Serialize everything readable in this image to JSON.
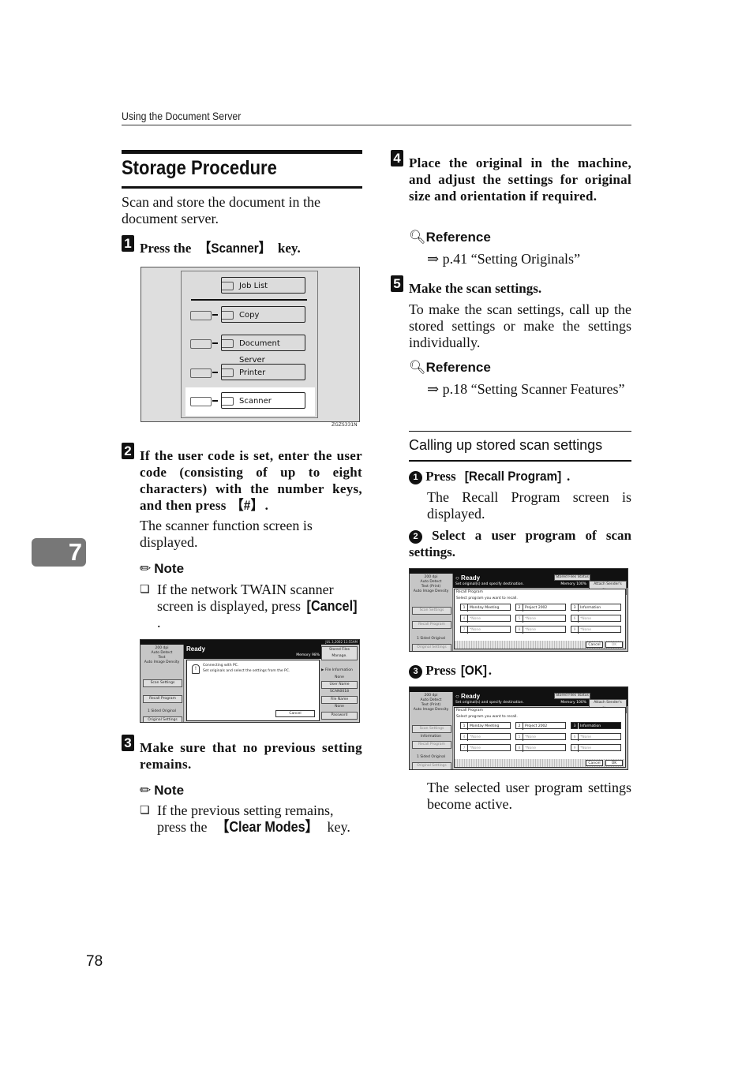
{
  "running_header": "Using the Document Server",
  "title": "Storage Procedure",
  "intro": "Scan and store the document in the document server.",
  "chapter_tab": "7",
  "page_number": "78",
  "steps": {
    "s1": {
      "num": "1",
      "pre": "Press the ",
      "key": "【Scanner】",
      "post": " key.",
      "figure": {
        "keys": [
          "Job List",
          "Copy",
          "Document Server",
          "Printer",
          "Scanner"
        ],
        "highlighted": "Scanner",
        "code": "ZGZS331N"
      }
    },
    "s2": {
      "num": "2",
      "text": "If the user code is set, enter the user code (consisting of up to eight characters) with the number keys, and then press ",
      "key": "【#】",
      "end": ".",
      "body": "The scanner function screen is displayed.",
      "note_title": "Note",
      "note_pre": "If the network TWAIN scanner screen is displayed, press ",
      "note_key": "[Cancel]",
      "note_post": ".",
      "screen": {
        "datetime": "JUL   3,2002 11:55AM",
        "status": "Ready",
        "memory": "Memory 98%",
        "left_info": [
          "200 dpi",
          "Auto Detect",
          "Text",
          "Auto Image Density"
        ],
        "left_buttons": [
          "Scan Settings",
          "Recall Program"
        ],
        "left_bottom_label": "1 Sided Original",
        "left_bottom_button": "Original Settings",
        "dialog_line1": "Connecting with PC.",
        "dialog_line2": "Set originals and select the settings from the PC.",
        "dialog_cancel": "Cancel",
        "right_top_button": "Stored Files Manage.",
        "right_info_title": "▶ File Information",
        "right_items": [
          {
            "value": "None",
            "button": "User Name"
          },
          {
            "value": "SCAN0018",
            "button": "File Name"
          },
          {
            "value": "None",
            "button": "Password"
          }
        ]
      }
    },
    "s3": {
      "num": "3",
      "text": "Make sure that no previous setting remains.",
      "note_title": "Note",
      "note_pre": "If the previous setting remains, press the ",
      "note_key": "【Clear Modes】",
      "note_post": " key."
    },
    "s4": {
      "num": "4",
      "text": "Place the original in the machine, and adjust the settings for original size and orientation if required.",
      "ref_title": "Reference",
      "ref_text": "⇒ p.41 “Setting Originals”"
    },
    "s5": {
      "num": "5",
      "text": "Make the scan settings.",
      "body": "To make the scan settings, call up the stored settings or make the settings individually.",
      "ref_title": "Reference",
      "ref_text": "⇒ p.18 “Setting Scanner Features”"
    }
  },
  "subsection": {
    "title": "Calling up stored scan settings",
    "sub1": {
      "num": "1",
      "pre": "Press ",
      "key": "[Recall Program]",
      "post": ".",
      "body": "The Recall Program screen is displayed."
    },
    "sub2": {
      "num": "2",
      "text": "Select a user program of scan settings."
    },
    "sub3": {
      "num": "3",
      "pre": "Press ",
      "key": "[OK]",
      "post": "."
    },
    "closing": "The selected user program settings become active."
  },
  "recall_screen": {
    "status": "Ready",
    "subtitle": "Set original(s) and specify destination.",
    "memory": "Memory 100%",
    "stored_files_button": "Stored Files Status",
    "attach_button": "Attach Sender's Name",
    "left_info": [
      "200 dpi",
      "Auto Detect",
      "Text (Print)",
      "Auto Image Density"
    ],
    "left_buttons": [
      "Scan Settings",
      "Recall Program"
    ],
    "left_bottom_label": "1 Sided Original",
    "left_bottom_button": "Original Settings",
    "panel_title": "Recall Program",
    "panel_prompt": "Select program you want to recall.",
    "programs": [
      {
        "n": "1",
        "name": "Monday Meeting"
      },
      {
        "n": "2",
        "name": "Project 2002"
      },
      {
        "n": "3",
        "name": "Information"
      },
      {
        "n": "4",
        "name": "*None"
      },
      {
        "n": "5",
        "name": "*None"
      },
      {
        "n": "6",
        "name": "*None"
      },
      {
        "n": "7",
        "name": "*None"
      },
      {
        "n": "8",
        "name": "*None"
      },
      {
        "n": "9",
        "name": "*None"
      }
    ],
    "cancel": "Cancel",
    "ok": "OK",
    "selected_label_after": "Information"
  }
}
